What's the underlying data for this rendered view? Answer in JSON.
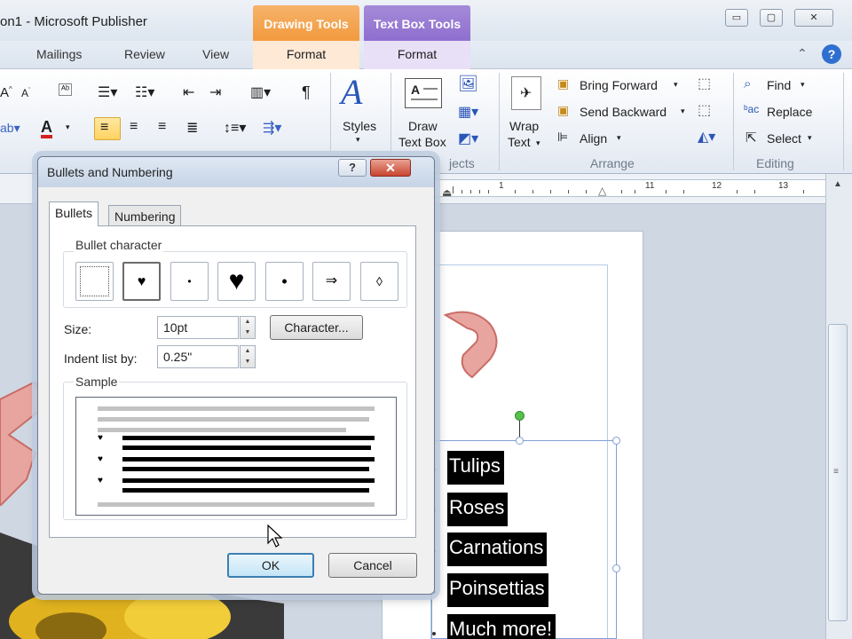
{
  "window": {
    "title": "on1  -  Microsoft Publisher",
    "contextual": [
      {
        "label": "Drawing Tools",
        "color": "#f29a3e"
      },
      {
        "label": "Text Box Tools",
        "color": "#8e6fcf"
      }
    ],
    "controls": {
      "minimize": "▭",
      "maximize": "▢",
      "close": "✕"
    }
  },
  "tabs": [
    {
      "label": "Mailings"
    },
    {
      "label": "Review"
    },
    {
      "label": "View"
    },
    {
      "label": "Format"
    },
    {
      "label": "Format"
    }
  ],
  "ribbon": {
    "styles": {
      "label": "Styles"
    },
    "draw_text_box": {
      "line1": "Draw",
      "line2": "Text Box"
    },
    "objects_group": "jects",
    "wrap_text": {
      "line1": "Wrap",
      "line2": "Text"
    },
    "arrange": {
      "bring_forward": "Bring Forward",
      "send_backward": "Send Backward",
      "align": "Align",
      "group_label": "Arrange"
    },
    "editing": {
      "find": "Find",
      "replace": "Replace",
      "select": "Select",
      "group_label": "Editing"
    }
  },
  "ruler": {
    "numbers": [
      "1",
      "11",
      "12",
      "13"
    ]
  },
  "textbox": {
    "items": [
      "Tulips",
      "Roses",
      "Carnations",
      "Poinsettias",
      "Much more!"
    ]
  },
  "dialog": {
    "title": "Bullets and Numbering",
    "help": "?",
    "close": "✕",
    "tabs": {
      "bullets": "Bullets",
      "numbering": "Numbering"
    },
    "bullet_character": {
      "legend": "Bullet character",
      "options": [
        "",
        "♥",
        "•",
        "♥",
        "•",
        "⇒",
        "◊"
      ],
      "selected_index": 1
    },
    "size": {
      "label": "Size:",
      "value": "10pt"
    },
    "character_button": "Character...",
    "indent": {
      "label": "Indent list by:",
      "value": "0.25\""
    },
    "sample": {
      "legend": "Sample",
      "bullet_glyph": "♥"
    },
    "ok": "OK",
    "cancel": "Cancel"
  },
  "colors": {
    "drawing_tools": "#f29a3e",
    "text_box_tools": "#8e6fcf",
    "wordart": "#d9807a",
    "selection_handle": "#55c14c"
  }
}
